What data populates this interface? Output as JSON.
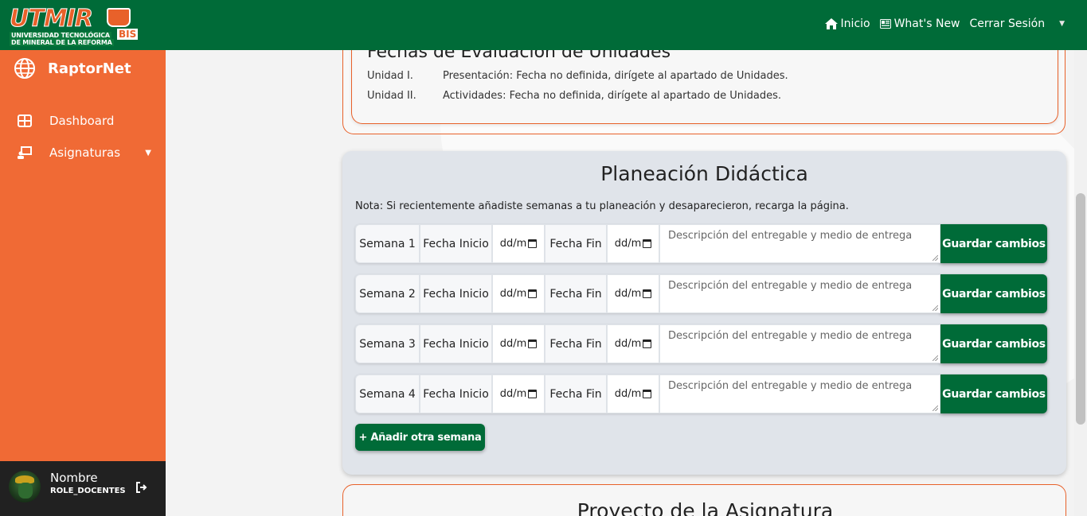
{
  "header": {
    "logo": {
      "brand": "UTMIR",
      "line1": "UNIVERSIDAD TECNOLÓGICA",
      "line2": "DE MINERAL DE LA REFORMA",
      "badge": "BIS"
    },
    "nav": {
      "inicio": "Inicio",
      "whats_new": "What's New",
      "logout": "Cerrar Sesión"
    },
    "icons": {
      "inicio": "home-icon",
      "whats_new": "newspaper-icon",
      "dropdown": "caret-down-icon"
    }
  },
  "sidebar": {
    "brand": "RaptorNet",
    "items": [
      {
        "label": "Dashboard",
        "icon": "dashboard-icon"
      },
      {
        "label": "Asignaturas",
        "icon": "chalkboard-teacher-icon"
      }
    ]
  },
  "user": {
    "name": "Nombre",
    "role": "ROLE_DOCENTES"
  },
  "evaluaciones": {
    "title": "Fechas de Evaluación de Unidades",
    "rows": [
      {
        "unit": "Unidad I.",
        "text": "Presentación: Fecha no definida, dirígete al apartado de Unidades."
      },
      {
        "unit": "Unidad II.",
        "text": "Actividades: Fecha no definida, dirígete al apartado de Unidades."
      }
    ]
  },
  "planeacion": {
    "title": "Planeación Didáctica",
    "note": "Nota: Si recientemente añadiste semanas a tu planeación y desaparecieron, recarga la página.",
    "fecha_inicio_label": "Fecha Inicio",
    "fecha_fin_label": "Fecha Fin",
    "date_placeholder": "dd/m",
    "desc_placeholder": "Descripción del entregable y medio de entrega",
    "save_label": "Guardar cambios",
    "weeks": [
      "Semana 1",
      "Semana 2",
      "Semana 3",
      "Semana 4"
    ],
    "add_label": "+ Añadir otra semana"
  },
  "proyecto": {
    "title": "Proyecto de la Asignatura"
  },
  "colors": {
    "primary_green": "#006b38",
    "sidebar_orange": "#f06a35",
    "accent_orange": "#e8612a"
  }
}
